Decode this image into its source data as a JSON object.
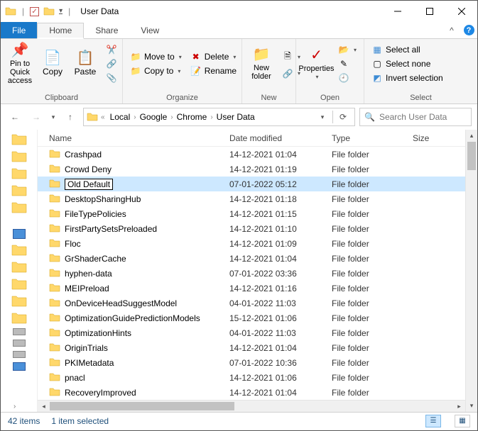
{
  "title": "User Data",
  "tabs": {
    "file": "File",
    "home": "Home",
    "share": "Share",
    "view": "View"
  },
  "ribbon": {
    "clipboard": {
      "label": "Clipboard",
      "pin": "Pin to Quick access",
      "copy": "Copy",
      "paste": "Paste"
    },
    "organize": {
      "label": "Organize",
      "moveto": "Move to",
      "copyto": "Copy to",
      "delete": "Delete",
      "rename": "Rename"
    },
    "new": {
      "label": "New",
      "newfolder": "New folder"
    },
    "open": {
      "label": "Open",
      "properties": "Properties"
    },
    "select": {
      "label": "Select",
      "selectall": "Select all",
      "selectnone": "Select none",
      "invert": "Invert selection"
    }
  },
  "breadcrumb": [
    "Local",
    "Google",
    "Chrome",
    "User Data"
  ],
  "search_placeholder": "Search User Data",
  "columns": {
    "name": "Name",
    "date": "Date modified",
    "type": "Type",
    "size": "Size"
  },
  "items": [
    {
      "name": "Crashpad",
      "date": "14-12-2021 01:04",
      "type": "File folder"
    },
    {
      "name": "Crowd Deny",
      "date": "14-12-2021 01:19",
      "type": "File folder"
    },
    {
      "name": "Old Default",
      "date": "07-01-2022 05:12",
      "type": "File folder",
      "selected": true,
      "rename": true
    },
    {
      "name": "DesktopSharingHub",
      "date": "14-12-2021 01:18",
      "type": "File folder"
    },
    {
      "name": "FileTypePolicies",
      "date": "14-12-2021 01:15",
      "type": "File folder"
    },
    {
      "name": "FirstPartySetsPreloaded",
      "date": "14-12-2021 01:10",
      "type": "File folder"
    },
    {
      "name": "Floc",
      "date": "14-12-2021 01:09",
      "type": "File folder"
    },
    {
      "name": "GrShaderCache",
      "date": "14-12-2021 01:04",
      "type": "File folder"
    },
    {
      "name": "hyphen-data",
      "date": "07-01-2022 03:36",
      "type": "File folder"
    },
    {
      "name": "MEIPreload",
      "date": "14-12-2021 01:16",
      "type": "File folder"
    },
    {
      "name": "OnDeviceHeadSuggestModel",
      "date": "04-01-2022 11:03",
      "type": "File folder"
    },
    {
      "name": "OptimizationGuidePredictionModels",
      "date": "15-12-2021 01:06",
      "type": "File folder"
    },
    {
      "name": "OptimizationHints",
      "date": "04-01-2022 11:03",
      "type": "File folder"
    },
    {
      "name": "OriginTrials",
      "date": "14-12-2021 01:04",
      "type": "File folder"
    },
    {
      "name": "PKIMetadata",
      "date": "07-01-2022 10:36",
      "type": "File folder"
    },
    {
      "name": "pnacl",
      "date": "14-12-2021 01:06",
      "type": "File folder"
    },
    {
      "name": "RecoveryImproved",
      "date": "14-12-2021 01:04",
      "type": "File folder"
    }
  ],
  "status": {
    "count": "42 items",
    "selection": "1 item selected"
  }
}
